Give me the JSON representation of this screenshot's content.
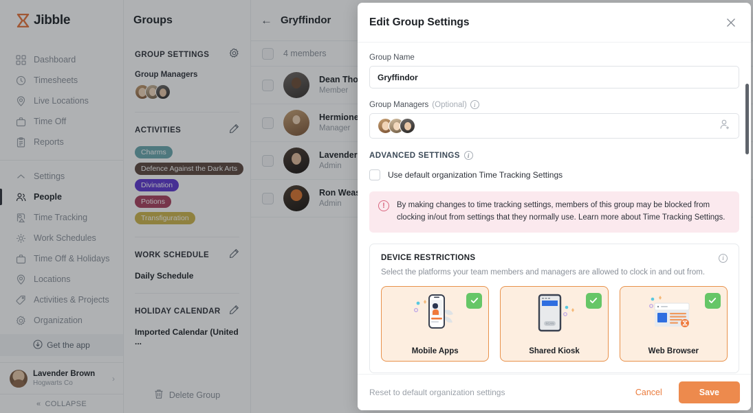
{
  "brand": {
    "name": "Jibble",
    "accent": "#e8743b"
  },
  "sidebar": {
    "items": [
      {
        "label": "Dashboard",
        "icon": "dashboard-icon"
      },
      {
        "label": "Timesheets",
        "icon": "clock-icon"
      },
      {
        "label": "Live Locations",
        "icon": "pin-icon"
      },
      {
        "label": "Time Off",
        "icon": "briefcase-icon"
      },
      {
        "label": "Reports",
        "icon": "clipboard-icon"
      }
    ],
    "settings_group": [
      {
        "label": "Settings",
        "icon": "chevron-up-icon"
      },
      {
        "label": "People",
        "icon": "people-icon"
      },
      {
        "label": "Time Tracking",
        "icon": "time-tracking-icon"
      },
      {
        "label": "Work Schedules",
        "icon": "work-schedules-icon"
      },
      {
        "label": "Time Off & Holidays",
        "icon": "briefcase-icon"
      },
      {
        "label": "Locations",
        "icon": "pin-icon"
      },
      {
        "label": "Activities & Projects",
        "icon": "tag-icon"
      },
      {
        "label": "Organization",
        "icon": "gear-icon"
      }
    ],
    "get_app": "Get the app",
    "user": {
      "name": "Lavender Brown",
      "org": "Hogwarts Co"
    },
    "collapse": "COLLAPSE"
  },
  "groups_panel": {
    "header": "Groups",
    "group_settings_title": "GROUP SETTINGS",
    "group_managers_label": "Group Managers",
    "activities_title": "ACTIVITIES",
    "activities": [
      {
        "label": "Charms",
        "color": "#68a6ac"
      },
      {
        "label": "Defence Against the Dark Arts",
        "color": "#5b463c"
      },
      {
        "label": "Divination",
        "color": "#5b34cf"
      },
      {
        "label": "Potions",
        "color": "#a83e5b"
      },
      {
        "label": "Transfiguration",
        "color": "#cdb44a"
      }
    ],
    "work_schedule_title": "WORK SCHEDULE",
    "work_schedule_value": "Daily Schedule",
    "holiday_calendar_title": "HOLIDAY CALENDAR",
    "holiday_calendar_value": "Imported Calendar (United ...",
    "delete_group": "Delete Group"
  },
  "members": {
    "title": "Gryffindor",
    "count_label": "4 members",
    "rows": [
      {
        "name": "Dean Thom",
        "role": "Member",
        "avatar": "av-dean"
      },
      {
        "name": "Hermione G",
        "role": "Manager",
        "avatar": "av-hermione"
      },
      {
        "name": "Lavender B",
        "role": "Admin",
        "avatar": "av-lavender"
      },
      {
        "name": "Ron Weasle",
        "role": "Admin",
        "avatar": "av-ron"
      }
    ]
  },
  "modal": {
    "title": "Edit Group Settings",
    "group_name_label": "Group Name",
    "group_name_value": "Gryffindor",
    "group_managers_label": "Group Managers",
    "group_managers_optional": "(Optional)",
    "advanced_settings_title": "ADVANCED SETTINGS",
    "use_default_label": "Use default organization Time Tracking Settings",
    "warning": "By making changes to time tracking settings, members of this group may be blocked from clocking in/out from settings that they normally use. Learn more about Time Tracking Settings.",
    "device_restrictions_title": "DEVICE RESTRICTIONS",
    "device_restrictions_sub": "Select the platforms your team members and managers are allowed to clock in and out from.",
    "platforms": [
      {
        "label": "Mobile Apps",
        "selected": true
      },
      {
        "label": "Shared Kiosk",
        "selected": true
      },
      {
        "label": "Web Browser",
        "selected": true
      }
    ],
    "reset_link": "Reset to default organization settings",
    "cancel_label": "Cancel",
    "save_label": "Save"
  }
}
